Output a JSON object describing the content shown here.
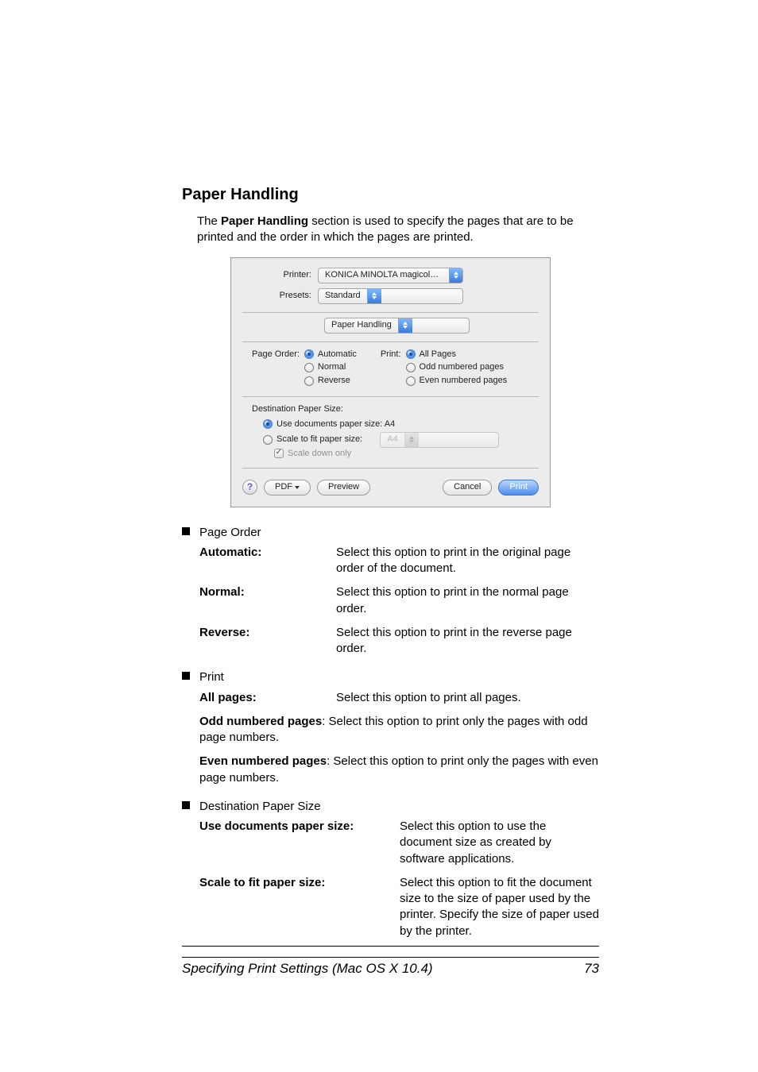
{
  "section_title": "Paper Handling",
  "intro_1": "The ",
  "intro_bold": "Paper Handling",
  "intro_2": " section is used to specify the pages that are to be printed and the order in which the pages are printed.",
  "dialog": {
    "labels": {
      "printer": "Printer:",
      "presets": "Presets:"
    },
    "printer_value": "KONICA MINOLTA magicolor …",
    "presets_value": "Standard",
    "pane_value": "Paper Handling",
    "page_order_label": "Page Order:",
    "po": {
      "automatic": "Automatic",
      "normal": "Normal",
      "reverse": "Reverse"
    },
    "print_label": "Print:",
    "pr": {
      "all": "All Pages",
      "odd": "Odd numbered pages",
      "even": "Even numbered pages"
    },
    "dest_title": "Destination Paper Size:",
    "use_doc": "Use documents paper size:  A4",
    "scale_fit": "Scale to fit paper size:",
    "scale_value": "A4",
    "scale_down": "Scale down only",
    "help": "?",
    "buttons": {
      "pdf": "PDF",
      "preview": "Preview",
      "cancel": "Cancel",
      "print": "Print"
    }
  },
  "page_order_heading": "Page Order",
  "defs_po": {
    "automatic_t": "Automatic",
    "automatic_d": "Select this option to print in the original page order of the document.",
    "normal_t": "Normal",
    "normal_d": "Select this option to print in the normal page order.",
    "reverse_t": "Reverse",
    "reverse_d": "Select this option to print in the reverse page order."
  },
  "print_heading": "Print",
  "defs_pr": {
    "all_t": "All pages",
    "all_d": "Select this option to print all pages.",
    "odd_t": "Odd numbered pages",
    "odd_d": ":  Select this option to print only the pages with odd page numbers.",
    "even_t": "Even numbered pages",
    "even_d": ": Select this option to print only the pages with even page numbers."
  },
  "dest_heading": "Destination Paper Size",
  "defs_dest": {
    "usedoc_t": "Use documents paper size",
    "usedoc_d": "Select this option to use the document size as created by software applications.",
    "scale_t": "Scale to fit paper size",
    "scale_d": "Select this option to fit the document size to the size of paper used by the printer. Specify the size of paper used by the printer."
  },
  "footer_text": "Specifying Print Settings (Mac OS X 10.4)",
  "footer_page": "73",
  "colon": ":"
}
